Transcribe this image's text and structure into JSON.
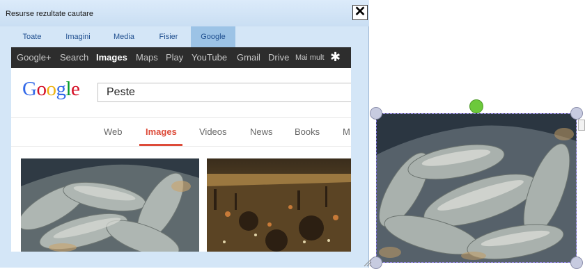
{
  "dialog": {
    "title": "Resurse rezultate cautare",
    "close_label": "✕",
    "tabs": [
      {
        "label": "Toate"
      },
      {
        "label": "Imagini"
      },
      {
        "label": "Media"
      },
      {
        "label": "Fisier"
      },
      {
        "label": "Google"
      }
    ],
    "active_tab": "Google"
  },
  "browser": {
    "gbar_items": [
      "Google+",
      "Search",
      "Images",
      "Maps",
      "Play",
      "YouTube",
      "Gmail",
      "Drive",
      "Mai mult"
    ],
    "gbar_active": "Images",
    "logo": "Google",
    "search_value": "Peste",
    "subnav": [
      "Web",
      "Images",
      "Videos",
      "News",
      "Books",
      "M"
    ],
    "subnav_active": "Images",
    "results": [
      {
        "icon": "fish-photo-thumbnail"
      },
      {
        "icon": "painting-thumbnail"
      }
    ]
  },
  "canvas": {
    "selected_image_icon": "fish-photo",
    "colors": {
      "selection": "#8a7be6",
      "rotate_handle": "#6cc93b",
      "handle": "#c7cbe0",
      "accent_red": "#dd4b39"
    }
  }
}
